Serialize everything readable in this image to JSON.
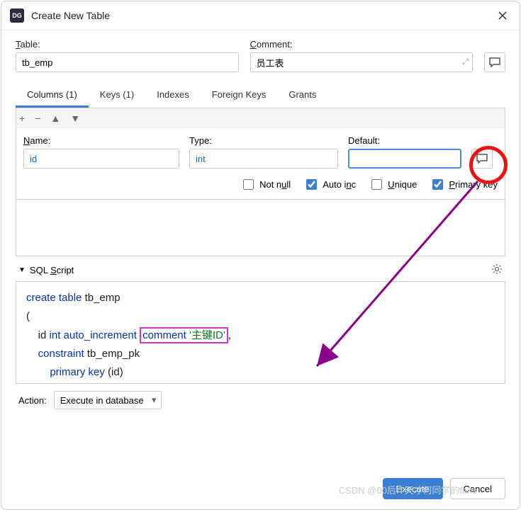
{
  "titlebar": {
    "title": "Create New Table",
    "app_icon_text": "DG"
  },
  "labels": {
    "table": "Table:",
    "comment": "Comment:",
    "name": "Name:",
    "type": "Type:",
    "default": "Default:",
    "not_null": "Not null",
    "auto_inc": "Auto inc",
    "unique": "Unique",
    "primary_key": "Primary key",
    "sql_script": "SQL Script",
    "action": "Action:"
  },
  "values": {
    "table": "tb_emp",
    "comment": "员工表",
    "col_name": "id",
    "col_type": "int",
    "col_default": "",
    "action_select": "Execute in database"
  },
  "checks": {
    "not_null": false,
    "auto_inc": true,
    "unique": false,
    "primary_key": true
  },
  "tabs": [
    {
      "label": "Columns (1)",
      "active": true
    },
    {
      "label": "Keys (1)",
      "active": false
    },
    {
      "label": "Indexes",
      "active": false
    },
    {
      "label": "Foreign Keys",
      "active": false
    },
    {
      "label": "Grants",
      "active": false
    }
  ],
  "tools": [
    "+",
    "−",
    "▲",
    "▼"
  ],
  "sql": {
    "l1_kw": "create table",
    "l1_id": "tb_emp",
    "l3_id": "id",
    "l3_type": "int",
    "l3_kw": "auto_increment",
    "l3_cm": "comment",
    "l3_str": "'主键ID'",
    "l4_kw": "constraint",
    "l4_id": "tb_emp_pk",
    "l5_kw": "primary key",
    "l5_id": "id"
  },
  "buttons": {
    "execute": "Execute",
    "cancel": "Cancel"
  },
  "watermark": "CSDN @00后IT天才何同学的fans"
}
